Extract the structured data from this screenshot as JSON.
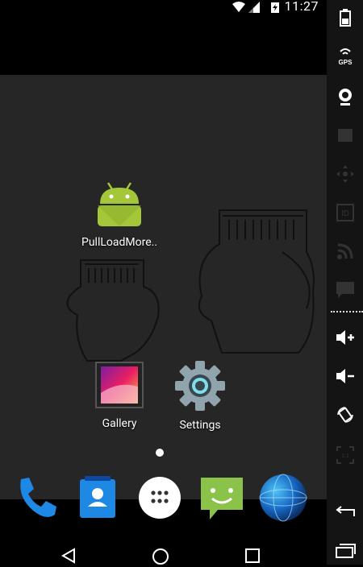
{
  "status_bar": {
    "time": "11:27"
  },
  "apps": [
    {
      "label": "PullLoadMore..",
      "icon": "android-app-icon"
    },
    {
      "label": "Gallery",
      "icon": "gallery-icon"
    },
    {
      "label": "Settings",
      "icon": "settings-gear-icon"
    }
  ],
  "dock": [
    "phone-icon",
    "contacts-icon",
    "app-drawer-icon",
    "messaging-icon",
    "browser-globe-icon"
  ],
  "side_controls": [
    "battery-icon",
    "gps-icon",
    "camera-icon",
    "video-icon",
    "move-icon",
    "id-icon",
    "rss-icon",
    "chat-icon",
    "volume-up-icon",
    "volume-down-icon",
    "rotate-icon",
    "scale-icon",
    "back-icon",
    "recents-icon"
  ],
  "colors": {
    "wallpaper": "#262626",
    "android_green": "#a4c639",
    "accent_blue": "#1e88e5"
  }
}
